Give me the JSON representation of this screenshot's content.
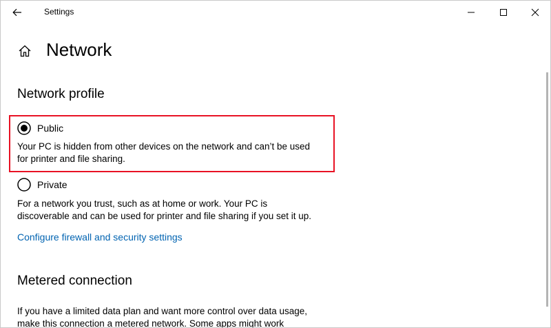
{
  "window": {
    "app_title": "Settings"
  },
  "page": {
    "title": "Network"
  },
  "network_profile": {
    "title": "Network profile",
    "options": [
      {
        "label": "Public",
        "selected": true,
        "description_lines": [
          "Your PC is hidden from other devices on the network and can’t be used",
          "for printer and file sharing."
        ]
      },
      {
        "label": "Private",
        "selected": false,
        "description_lines": [
          "For a network you trust, such as at home or work. Your PC is",
          "discoverable and can be used for printer and file sharing if you set it up."
        ]
      }
    ],
    "link": "Configure firewall and security settings"
  },
  "metered": {
    "title": "Metered connection",
    "description_lines": [
      "If you have a limited data plan and want more control over data usage,",
      "make this connection a metered network. Some apps might work"
    ]
  },
  "colors": {
    "accent": "#0063b1",
    "highlight": "#e81123",
    "radio_selected": "#000000"
  },
  "icons": {
    "back": "back-arrow-icon",
    "home": "home-icon",
    "minimize": "minimize-icon",
    "maximize": "maximize-icon",
    "close": "close-icon"
  }
}
